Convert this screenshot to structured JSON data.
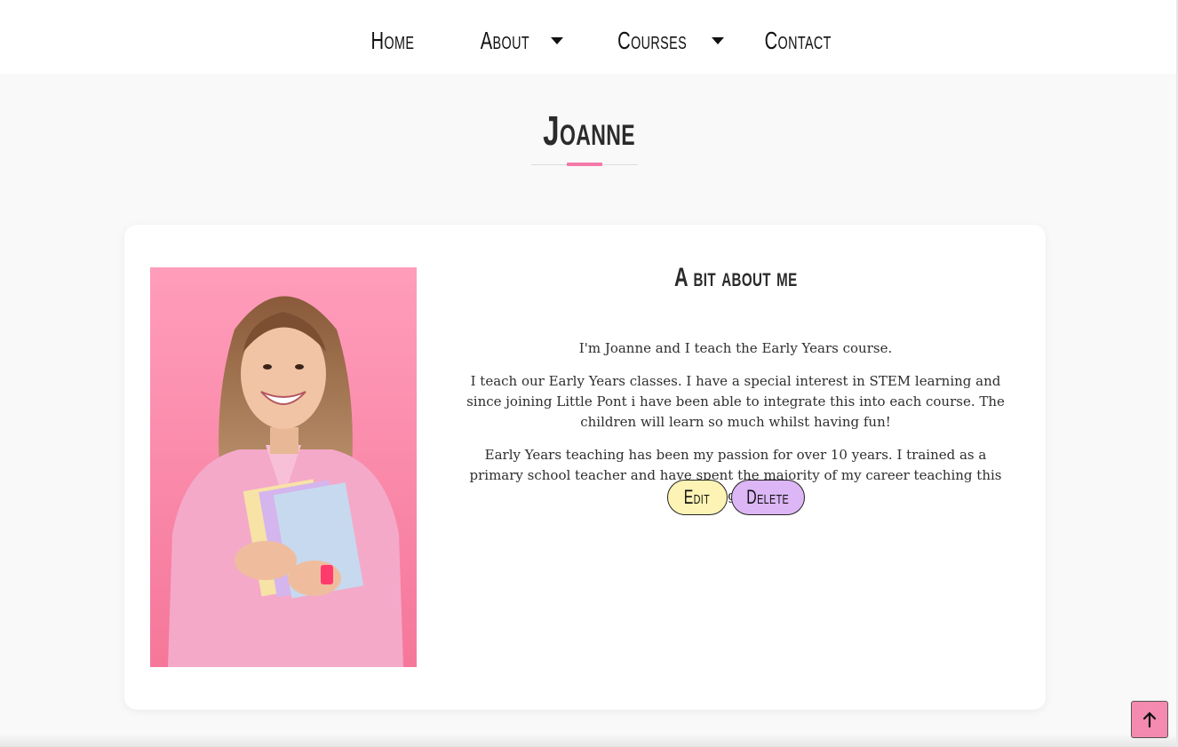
{
  "nav": {
    "items": [
      {
        "label": "Home",
        "has_dropdown": false
      },
      {
        "label": "About",
        "has_dropdown": true
      },
      {
        "label": "Courses",
        "has_dropdown": true
      },
      {
        "label": "Contact",
        "has_dropdown": false
      }
    ]
  },
  "page": {
    "title": "Joanne"
  },
  "profile": {
    "heading": "A bit about me",
    "paragraphs": [
      "I'm Joanne and I teach the Early Years course.",
      "I teach our Early Years classes. I have a special interest in STEM learning and since joining Little Pont i have been able to integrate this into each course. The children will learn so much whilst having fun!",
      "Early Years teaching has been my passion for over 10 years. I trained as a primary school teacher and have spent the majority of my career teaching this age group."
    ],
    "photo_icon": "teacher-portrait",
    "edit_label": "Edit",
    "delete_label": "Delete"
  },
  "colors": {
    "accent_pink": "#f47aa8",
    "edit_button": "#fdf3b5",
    "delete_button": "#dcb6f5",
    "back_to_top": "#f48ab0"
  },
  "back_to_top_icon": "arrow-up-icon"
}
